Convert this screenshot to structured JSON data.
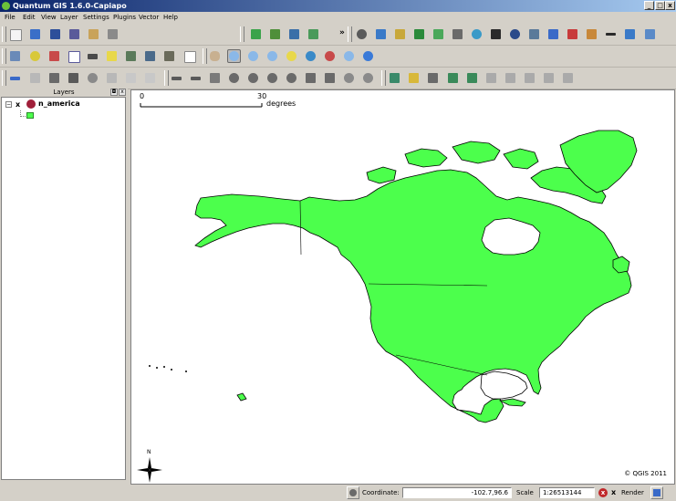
{
  "window": {
    "title": "Quantum GIS 1.6.0-Capiapo",
    "min_label": "_",
    "max_label": "□",
    "close_label": "x"
  },
  "menubar": {
    "items": [
      "File",
      "Edit",
      "View",
      "Layer",
      "Settings",
      "Plugins",
      "Vector",
      "Help"
    ]
  },
  "toolbar": {
    "overflow_label": "»"
  },
  "layers_panel": {
    "title": "Layers",
    "float_label": "◘",
    "close_label": "x",
    "expander": "−",
    "check": "x",
    "layer_name": "n_america",
    "layer_visible": true
  },
  "map": {
    "scalebar_min": "0",
    "scalebar_max": "30",
    "scalebar_unit": "degrees",
    "north_label": "N",
    "copyright": "© QGIS 2011",
    "fill_color": "#4cff4c",
    "outline_color": "#000000"
  },
  "statusbar": {
    "coordinate_label": "Coordinate:",
    "coordinate_value": "-102.7,96.6",
    "scale_label": "Scale",
    "scale_value": "1:26513144",
    "stop_label": "x",
    "render_check": "x",
    "render_label": "Render",
    "render_checked": true
  },
  "colors": {
    "titlebar_start": "#0a246a",
    "titlebar_end": "#a6caf0",
    "chrome": "#d4d0c8",
    "layer_fill": "#4cff4c"
  },
  "icons": {
    "toolbar_row1": [
      "new-project-icon",
      "open-project-icon",
      "save-project-icon",
      "save-as-icon",
      "print-composer-icon",
      "print-icon",
      "add-vector-layer-icon",
      "add-raster-layer-icon",
      "add-postgis-layer-icon",
      "add-spatialite-layer-icon",
      "overflow-chevron-icon",
      "copyright-label-icon",
      "grid-maker-icon",
      "dxf-export-icon",
      "spatial-query-icon",
      "georeferencer-icon",
      "raster-terrain-icon",
      "openstreetmap-icon",
      "interpolation-icon",
      "north-arrow-icon",
      "gps-icon",
      "eval-icon",
      "pdf-icon",
      "digitize-icon",
      "scalebar-decoration-icon",
      "plugin-manager-icon",
      "image-icon"
    ],
    "toolbar_row2": [
      "open-table-icon",
      "identify-icon",
      "select-icon",
      "attribute-table-icon",
      "measure-line-icon",
      "map-tips-icon",
      "new-bookmark-icon",
      "show-bookmarks-icon",
      "measure-area-icon",
      "text-annotation-icon",
      "pan-icon",
      "zoom-in-icon",
      "zoom-out-icon",
      "zoom-full-icon",
      "zoom-layer-icon",
      "zoom-selection-icon",
      "zoom-last-icon",
      "zoom-next-icon",
      "refresh-icon"
    ],
    "toolbar_row3": [
      "toggle-editing-icon",
      "save-edits-icon",
      "move-feature-icon",
      "node-tool-icon",
      "delete-selected-icon",
      "cut-features-icon",
      "copy-features-icon",
      "paste-features-icon",
      "undo-icon",
      "redo-icon",
      "simplify-icon",
      "add-ring-icon",
      "add-part-icon",
      "delete-ring-icon",
      "delete-part-icon",
      "reshape-icon",
      "split-features-icon",
      "merge-features-icon",
      "merge-attributes-icon",
      "rotate-label-icon",
      "rotate-point-icon",
      "new-layer-icon",
      "new-shapefile-icon",
      "new-spatialite-icon",
      "pin-labels-icon",
      "show-labels-icon",
      "move-label-icon",
      "rotate-labels-icon",
      "change-label-icon",
      "remove-layer-icon",
      "overview-icon",
      "properties-icon",
      "layer-properties-icon",
      "hide-layer-icon"
    ]
  }
}
